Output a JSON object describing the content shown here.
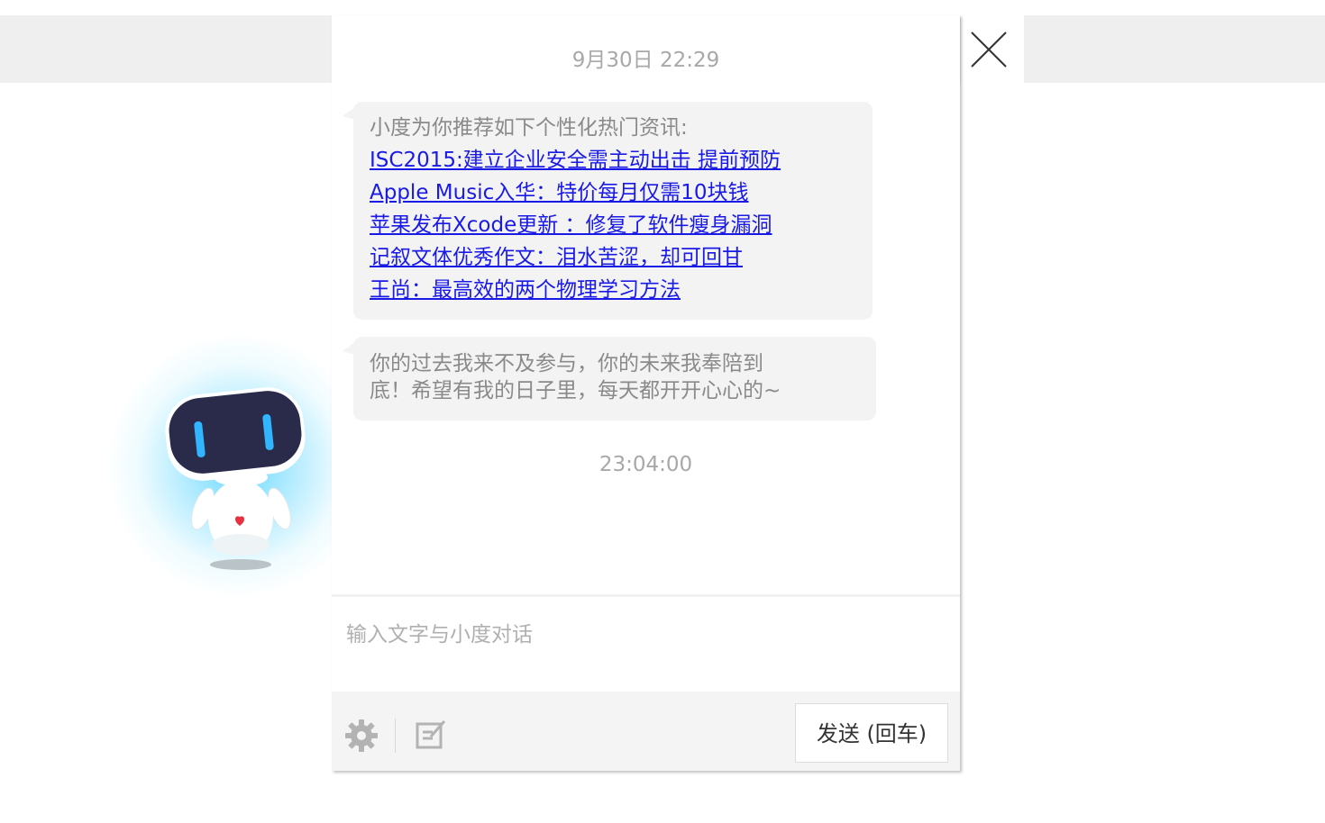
{
  "chat": {
    "timestamp_1": "9月30日 22:29",
    "timestamp_2": "23:04:00",
    "bubble_1": {
      "intro": "小度为你推荐如下个性化热门资讯:",
      "links": [
        "ISC2015:建立企业安全需主动出击 提前预防",
        "Apple Music入华：特价每月仅需10块钱",
        "苹果发布Xcode更新 ：修复了软件瘦身漏洞",
        "记叙文体优秀作文：泪水苦涩，却可回甘",
        "王尚：最高效的两个物理学习方法"
      ]
    },
    "bubble_2": {
      "line_1": "你的过去我来不及参与，你的未来我奉陪到",
      "line_2": "底！希望有我的日子里，每天都开开心心的~"
    }
  },
  "input": {
    "placeholder": "输入文字与小度对话",
    "value": ""
  },
  "toolbar": {
    "send_label": "发送 (回车)",
    "settings_icon": "gear-icon",
    "edit_icon": "edit-icon"
  },
  "window": {
    "close_icon": "close-icon"
  },
  "colors": {
    "link": "#1a1ae6",
    "bubble_bg": "#f3f3f3",
    "text_gray": "#8a8a8a",
    "top_band": "#efefef",
    "robot_glow": "#50d2ff"
  }
}
